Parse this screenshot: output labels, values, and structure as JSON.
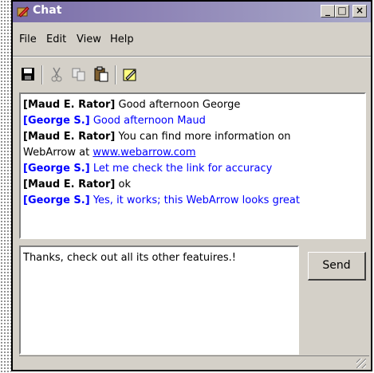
{
  "window": {
    "title": "Chat",
    "controls": {
      "minimize": "_",
      "maximize": "□",
      "close": "×"
    }
  },
  "menu": [
    "File",
    "Edit",
    "View",
    "Help"
  ],
  "toolbar": [
    "save-icon",
    "cut-icon",
    "copy-icon",
    "paste-icon",
    "clear-icon"
  ],
  "messages": [
    {
      "sender": "[Maud E. Rator]",
      "text": "Good afternoon George",
      "color": "#000000"
    },
    {
      "sender": "[George S.]",
      "text": "Good afternoon Maud",
      "color": "#0000ff"
    },
    {
      "sender": "[Maud E. Rator]",
      "text": "You can find more information on",
      "text2": "WebArrow at ",
      "link": "www.webarrow.com",
      "color": "#000000"
    },
    {
      "sender": "[George S.]",
      "text": "Let me check the link for accuracy",
      "color": "#0000ff"
    },
    {
      "sender": "[Maud E. Rator]",
      "text": "ok",
      "color": "#000000"
    },
    {
      "sender": "[George S.]",
      "text": "Yes, it works; this WebArrow looks great",
      "color": "#0000ff"
    }
  ],
  "compose": {
    "value": "Thanks, check out all its other featuires.!"
  },
  "send_button": "Send"
}
